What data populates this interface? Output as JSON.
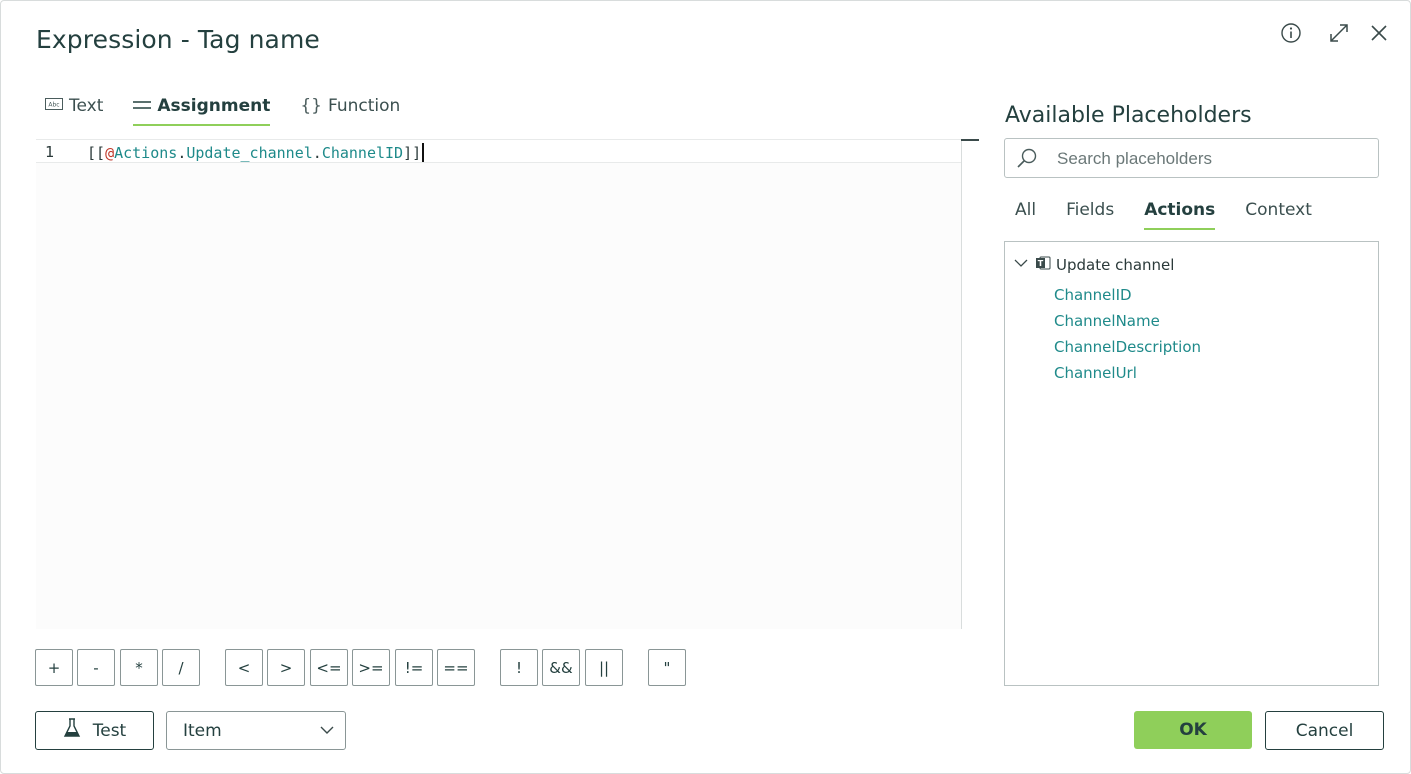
{
  "dialog": {
    "title": "Expression - Tag name",
    "header_icons": [
      "info-icon",
      "expand-icon",
      "close-icon"
    ]
  },
  "editor_tabs": [
    {
      "label": "Text",
      "icon": "abc-text-icon",
      "active": false
    },
    {
      "label": "Assignment",
      "icon": "equals-icon",
      "active": true
    },
    {
      "label": "Function",
      "icon": "braces-icon",
      "active": false
    }
  ],
  "editor": {
    "line_number": "1",
    "code_prefix": "[[",
    "code_at": "@",
    "code_parts": [
      "Actions",
      ".",
      "Update_channel",
      ".",
      "ChannelID"
    ],
    "code_suffix": "]]"
  },
  "operators": [
    "+",
    "-",
    "*",
    "/",
    "<",
    ">",
    "<=",
    ">=",
    "!=",
    "==",
    "!",
    "&&",
    "||",
    "\""
  ],
  "footer": {
    "test_label": "Test",
    "select_value": "Item",
    "ok_label": "OK",
    "cancel_label": "Cancel"
  },
  "placeholders": {
    "title": "Available Placeholders",
    "search_placeholder": "Search placeholders",
    "tabs": [
      {
        "label": "All",
        "active": false
      },
      {
        "label": "Fields",
        "active": false
      },
      {
        "label": "Actions",
        "active": true
      },
      {
        "label": "Context",
        "active": false
      }
    ],
    "tree": {
      "group_label": "Update channel",
      "items": [
        "ChannelID",
        "ChannelName",
        "ChannelDescription",
        "ChannelUrl"
      ]
    }
  },
  "colors": {
    "accent_green": "#8fcf5a",
    "teal_text": "#1f8a8a",
    "dark_text": "#24403f",
    "at_red": "#c0392b"
  }
}
